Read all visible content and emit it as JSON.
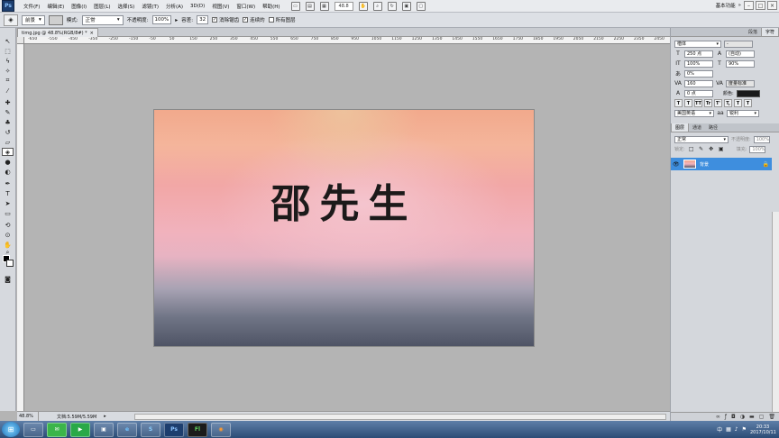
{
  "menubar": {
    "logo": "Ps",
    "items": [
      "文件(F)",
      "编辑(E)",
      "图像(I)",
      "图层(L)",
      "选择(S)",
      "滤镜(T)",
      "分析(A)",
      "3D(D)",
      "视图(V)",
      "窗口(W)",
      "帮助(H)"
    ],
    "zoom": "48.8",
    "workspace": "基本功能"
  },
  "options": {
    "preset": "前景",
    "mode_label": "模式:",
    "mode_value": "正常",
    "opacity_label": "不透明度:",
    "opacity_value": "100%",
    "tolerance_label": "容差:",
    "tolerance_value": "32",
    "anti_alias": "消除锯齿",
    "contiguous": "连续的",
    "all_layers": "所有图层"
  },
  "document": {
    "tab_title": "timg.jpg @ 48.8%(RGB/8#) *",
    "canvas_text": "邵先生",
    "ruler_ticks": [
      "-650",
      "-600",
      "-550",
      "-500",
      "-450",
      "-400",
      "-350",
      "-300",
      "-250",
      "-200",
      "-150",
      "-100",
      "-50",
      "0",
      "50",
      "100",
      "150",
      "200",
      "250",
      "300",
      "350",
      "400",
      "450",
      "500",
      "550",
      "600",
      "650",
      "700",
      "750",
      "800",
      "850",
      "900",
      "950",
      "1000",
      "1050",
      "1100",
      "1150",
      "1200",
      "1250",
      "1300",
      "1350",
      "1400",
      "1450",
      "1500",
      "1550",
      "1600",
      "1650",
      "1700",
      "1750",
      "1800",
      "1850",
      "1900",
      "1950",
      "2000",
      "2050",
      "2100",
      "2150",
      "2200",
      "2250",
      "2300",
      "2350",
      "2400",
      "2450"
    ]
  },
  "status": {
    "zoom": "48.8%",
    "doc_size": "文档:5.59M/5.59M"
  },
  "character_panel": {
    "tabs": [
      "段落",
      "字符"
    ],
    "font_family": "楷体",
    "font_style": "-",
    "font_size": "250 点",
    "leading": "(自动)",
    "vertical_scale": "100%",
    "horizontal_scale": "90%",
    "tracking_ratio": "0%",
    "kerning": "160",
    "kerning_method": "度量标准",
    "baseline_shift": "0 点",
    "color_label": "颜色:",
    "format_buttons": [
      "T",
      "T",
      "TT",
      "Tr",
      "T'",
      "T,",
      "T",
      "T"
    ],
    "language": "美国英语",
    "antialias": "锐利"
  },
  "layers_panel": {
    "tabs": [
      "图层",
      "通道",
      "路径"
    ],
    "blend_mode": "正常",
    "opacity_label": "不透明度:",
    "opacity_value": "100%",
    "lock_label": "锁定:",
    "fill_label": "填充:",
    "fill_value": "100%",
    "layer_name": "背景"
  },
  "taskbar": {
    "apps": [
      "e",
      "S",
      "Ps",
      "Fl"
    ],
    "time": "20:33",
    "date": "2017/10/11"
  },
  "colors": {
    "selection": "#3e8ede",
    "panel": "#d4d7dc"
  }
}
